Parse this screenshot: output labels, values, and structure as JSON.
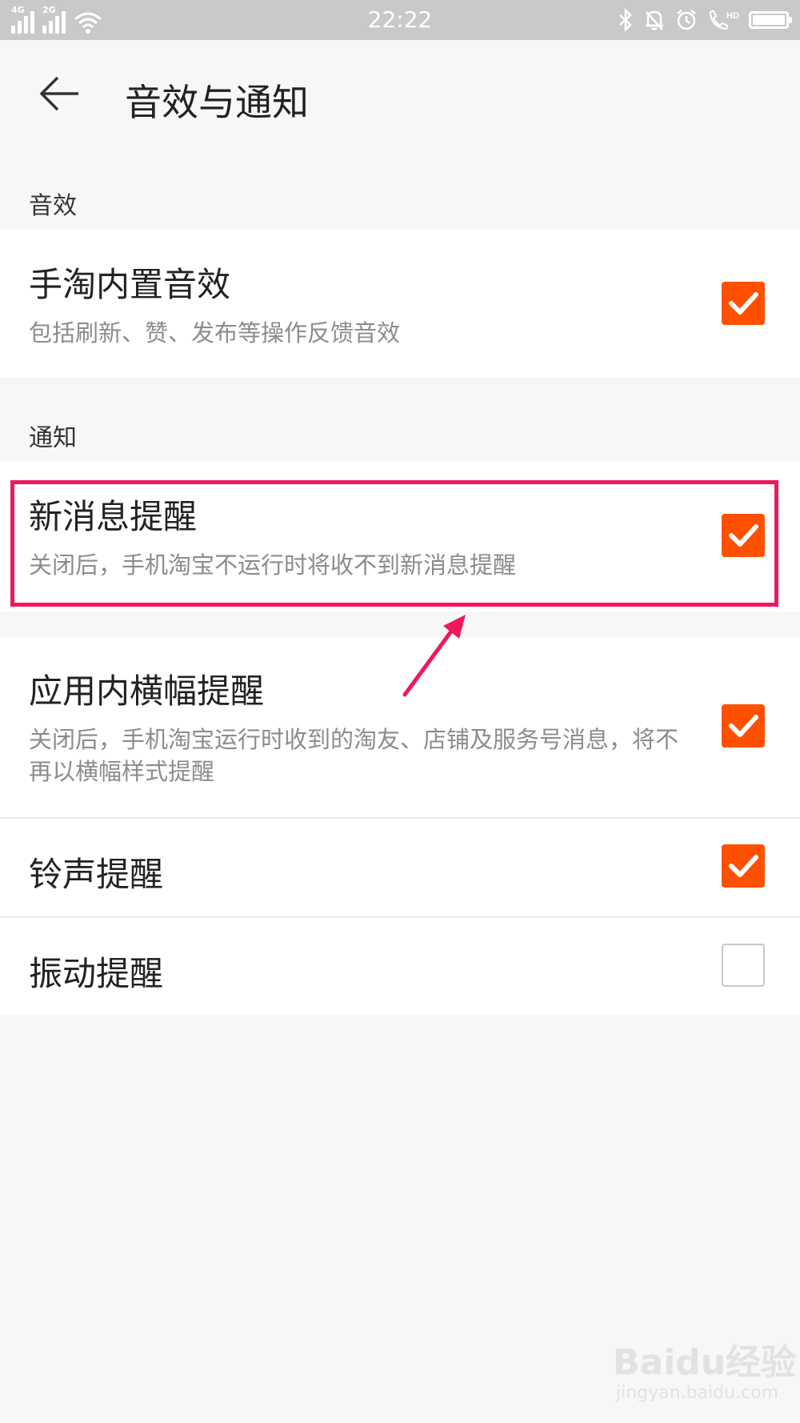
{
  "status_bar": {
    "sim1_label": "4G",
    "sim2_label": "2G",
    "time": "22:22",
    "icons": [
      "bluetooth-icon",
      "bell-icon",
      "alarm-icon",
      "phone-hd-icon",
      "battery-icon"
    ]
  },
  "header": {
    "back_icon": "arrow-left-icon",
    "title": "音效与通知"
  },
  "sections": [
    {
      "label": "音效",
      "items": [
        {
          "title": "手淘内置音效",
          "description": "包括刷新、赞、发布等操作反馈音效",
          "checked": true
        }
      ]
    },
    {
      "label": "通知",
      "items": [
        {
          "title": "新消息提醒",
          "description": "关闭后，手机淘宝不运行时将收不到新消息提醒",
          "checked": true,
          "highlighted": true
        },
        {
          "title": "应用内横幅提醒",
          "description": "关闭后，手机淘宝运行时收到的淘友、店铺及服务号消息，将不再以横幅样式提醒",
          "checked": true
        },
        {
          "title": "铃声提醒",
          "checked": true
        },
        {
          "title": "振动提醒",
          "checked": false
        }
      ]
    }
  ],
  "colors": {
    "accent": "#ff5000",
    "highlight": "#f0185a"
  },
  "watermark": {
    "logo": "Baidu经验",
    "url": "jingyan.baidu.com"
  }
}
